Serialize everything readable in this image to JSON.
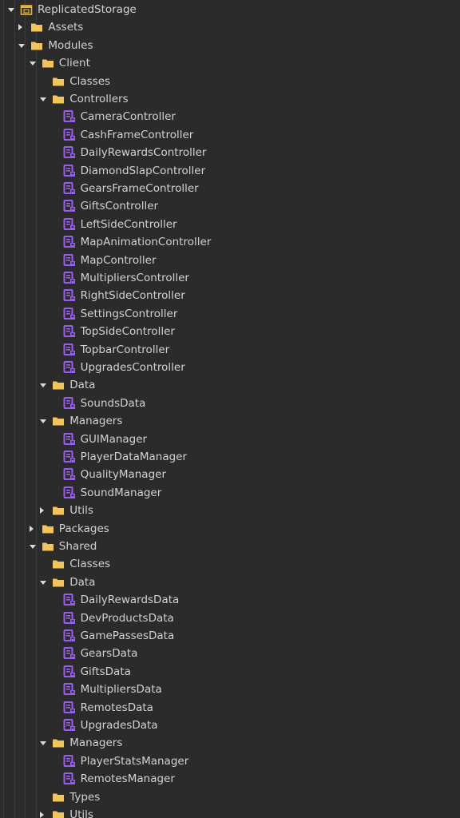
{
  "explorer": {
    "nodes": [
      {
        "label": "ReplicatedStorage",
        "depth": 0,
        "icon": "replicated-storage-icon",
        "expand": "expanded"
      },
      {
        "label": "Assets",
        "depth": 1,
        "icon": "folder-icon",
        "expand": "collapsed"
      },
      {
        "label": "Modules",
        "depth": 1,
        "icon": "folder-icon",
        "expand": "expanded"
      },
      {
        "label": "Client",
        "depth": 2,
        "icon": "folder-icon",
        "expand": "expanded"
      },
      {
        "label": "Classes",
        "depth": 3,
        "icon": "folder-icon",
        "expand": "none"
      },
      {
        "label": "Controllers",
        "depth": 3,
        "icon": "folder-icon",
        "expand": "expanded"
      },
      {
        "label": "CameraController",
        "depth": 4,
        "icon": "module-script-icon",
        "expand": "none"
      },
      {
        "label": "CashFrameController",
        "depth": 4,
        "icon": "module-script-icon",
        "expand": "none"
      },
      {
        "label": "DailyRewardsController",
        "depth": 4,
        "icon": "module-script-icon",
        "expand": "none"
      },
      {
        "label": "DiamondSlapController",
        "depth": 4,
        "icon": "module-script-icon",
        "expand": "none"
      },
      {
        "label": "GearsFrameController",
        "depth": 4,
        "icon": "module-script-icon",
        "expand": "none"
      },
      {
        "label": "GiftsController",
        "depth": 4,
        "icon": "module-script-icon",
        "expand": "none"
      },
      {
        "label": "LeftSideController",
        "depth": 4,
        "icon": "module-script-icon",
        "expand": "none"
      },
      {
        "label": "MapAnimationController",
        "depth": 4,
        "icon": "module-script-icon",
        "expand": "none"
      },
      {
        "label": "MapController",
        "depth": 4,
        "icon": "module-script-icon",
        "expand": "none"
      },
      {
        "label": "MultipliersController",
        "depth": 4,
        "icon": "module-script-icon",
        "expand": "none"
      },
      {
        "label": "RightSideController",
        "depth": 4,
        "icon": "module-script-icon",
        "expand": "none"
      },
      {
        "label": "SettingsController",
        "depth": 4,
        "icon": "module-script-icon",
        "expand": "none"
      },
      {
        "label": "TopSideController",
        "depth": 4,
        "icon": "module-script-icon",
        "expand": "none"
      },
      {
        "label": "TopbarController",
        "depth": 4,
        "icon": "module-script-icon",
        "expand": "none"
      },
      {
        "label": "UpgradesController",
        "depth": 4,
        "icon": "module-script-icon",
        "expand": "none"
      },
      {
        "label": "Data",
        "depth": 3,
        "icon": "folder-icon",
        "expand": "expanded"
      },
      {
        "label": "SoundsData",
        "depth": 4,
        "icon": "module-script-icon",
        "expand": "none"
      },
      {
        "label": "Managers",
        "depth": 3,
        "icon": "folder-icon",
        "expand": "expanded"
      },
      {
        "label": "GUIManager",
        "depth": 4,
        "icon": "module-script-icon",
        "expand": "none"
      },
      {
        "label": "PlayerDataManager",
        "depth": 4,
        "icon": "module-script-icon",
        "expand": "none"
      },
      {
        "label": "QualityManager",
        "depth": 4,
        "icon": "module-script-icon",
        "expand": "none"
      },
      {
        "label": "SoundManager",
        "depth": 4,
        "icon": "module-script-icon",
        "expand": "none"
      },
      {
        "label": "Utils",
        "depth": 3,
        "icon": "folder-icon",
        "expand": "collapsed"
      },
      {
        "label": "Packages",
        "depth": 2,
        "icon": "folder-icon",
        "expand": "collapsed"
      },
      {
        "label": "Shared",
        "depth": 2,
        "icon": "folder-icon",
        "expand": "expanded"
      },
      {
        "label": "Classes",
        "depth": 3,
        "icon": "folder-icon",
        "expand": "none"
      },
      {
        "label": "Data",
        "depth": 3,
        "icon": "folder-icon",
        "expand": "expanded"
      },
      {
        "label": "DailyRewardsData",
        "depth": 4,
        "icon": "module-script-icon",
        "expand": "none"
      },
      {
        "label": "DevProductsData",
        "depth": 4,
        "icon": "module-script-icon",
        "expand": "none"
      },
      {
        "label": "GamePassesData",
        "depth": 4,
        "icon": "module-script-icon",
        "expand": "none"
      },
      {
        "label": "GearsData",
        "depth": 4,
        "icon": "module-script-icon",
        "expand": "none"
      },
      {
        "label": "GiftsData",
        "depth": 4,
        "icon": "module-script-icon",
        "expand": "none"
      },
      {
        "label": "MultipliersData",
        "depth": 4,
        "icon": "module-script-icon",
        "expand": "none"
      },
      {
        "label": "RemotesData",
        "depth": 4,
        "icon": "module-script-icon",
        "expand": "none"
      },
      {
        "label": "UpgradesData",
        "depth": 4,
        "icon": "module-script-icon",
        "expand": "none"
      },
      {
        "label": "Managers",
        "depth": 3,
        "icon": "folder-icon",
        "expand": "expanded"
      },
      {
        "label": "PlayerStatsManager",
        "depth": 4,
        "icon": "module-script-icon",
        "expand": "none"
      },
      {
        "label": "RemotesManager",
        "depth": 4,
        "icon": "module-script-icon",
        "expand": "none"
      },
      {
        "label": "Types",
        "depth": 3,
        "icon": "folder-icon",
        "expand": "none"
      },
      {
        "label": "Utils",
        "depth": 3,
        "icon": "folder-icon",
        "expand": "collapsed"
      }
    ]
  },
  "colors": {
    "background": "#2b2b2b",
    "text": "#d2d2d2",
    "folder": "#f2c45a",
    "module_script": "#9a5cf5",
    "replicated_storage": "#e6b23a"
  }
}
